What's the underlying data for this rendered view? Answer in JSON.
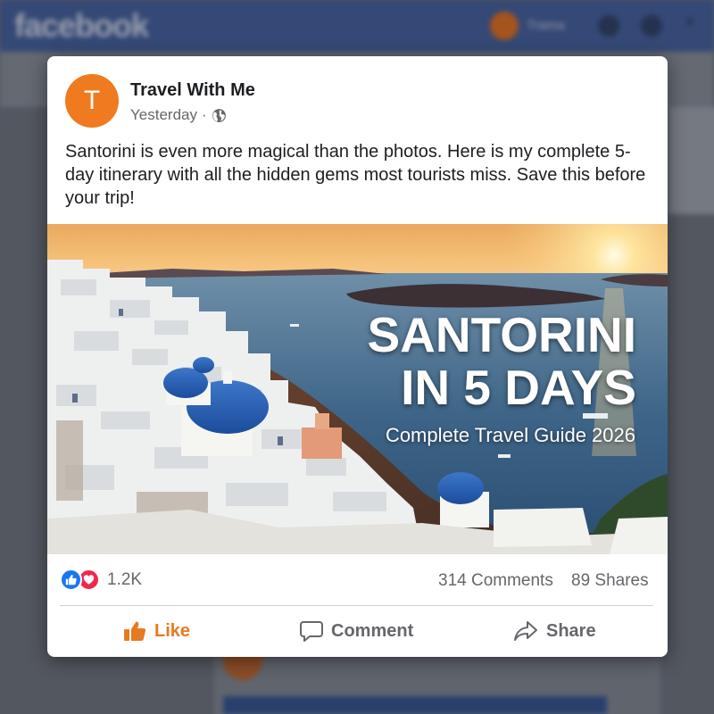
{
  "background": {
    "logo": "facebook",
    "user_name": "Trama"
  },
  "post": {
    "avatar_letter": "T",
    "author": "Travel With Me",
    "timestamp": "Yesterday",
    "separator": "·",
    "privacy_icon": "globe-icon",
    "text": "Santorini is even more magical than the photos. Here is my complete 5-day itinerary with all the hidden gems most tourists miss. Save this before your trip!",
    "image": {
      "title_line1": "SANTORINI",
      "title_line2": "IN 5 DAYS",
      "subtitle": "Complete Travel Guide 2026"
    },
    "stats": {
      "reactions_count": "1.2K",
      "comments": "314 Comments",
      "shares": "89 Shares"
    },
    "actions": {
      "like": "Like",
      "comment": "Comment",
      "share": "Share"
    }
  },
  "colors": {
    "brand_blue": "#3b5998",
    "like_orange": "#e67a20",
    "reaction_like": "#1877f2",
    "reaction_love": "#f0284a",
    "avatar_orange": "#ef7a1f"
  }
}
